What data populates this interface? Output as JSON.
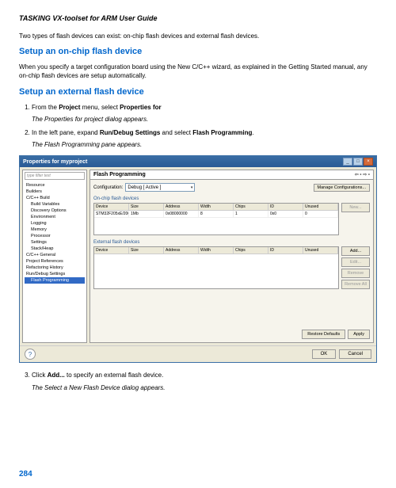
{
  "doc": {
    "header": "TASKING VX-toolset for ARM User Guide",
    "intro": "Two types of flash devices can exist: on-chip flash devices and external flash devices.",
    "h1": "Setup an on-chip flash device",
    "p1": "When you specify a target configuration board using the New C/C++ wizard, as explained in the Getting Started manual, any on-chip flash devices are setup automatically.",
    "h2": "Setup an external flash device",
    "step1_a": "From the ",
    "step1_b": "Project",
    "step1_c": " menu, select ",
    "step1_d": "Properties for",
    "step1_note": "The Properties for project dialog appears.",
    "step2_a": "In the left pane, expand ",
    "step2_b": "Run/Debug Settings",
    "step2_c": " and select ",
    "step2_d": "Flash Programming",
    "step2_e": ".",
    "step2_note": "The Flash Programming pane appears.",
    "step3_a": "Click ",
    "step3_b": "Add...",
    "step3_c": " to specify an external flash device.",
    "step3_note": "The Select a New Flash Device dialog appears.",
    "pagenum": "284"
  },
  "dialog": {
    "title": "Properties for myproject",
    "filter_placeholder": "type filter text",
    "tree": {
      "resource": "Resource",
      "builders": "Builders",
      "ccbuild": "C/C++ Build",
      "buildvars": "Build Variables",
      "discovery": "Discovery Options",
      "environment": "Environment",
      "logging": "Logging",
      "memory": "Memory",
      "processor": "Processor",
      "settings": "Settings",
      "stack": "Stack/Heap",
      "ccgeneral": "C/C++ General",
      "projrefs": "Project References",
      "refactoring": "Refactoring History",
      "rundebug": "Run/Debug Settings",
      "flashprog": "Flash Programming"
    },
    "pane_title": "Flash Programming",
    "config_label": "Configuration:",
    "config_value": "Debug [ Active ]",
    "manage": "Manage Configurations...",
    "onchip_label": "On-chip flash devices",
    "external_label": "External flash devices",
    "cols": {
      "device": "Device",
      "size": "Size",
      "address": "Address",
      "width": "Width",
      "chips": "Chips",
      "id": "ID",
      "unused": "Unused"
    },
    "row1": {
      "device": "STM32F205xE/206E",
      "size": "1Mb",
      "address": "0x08000000",
      "width": "8",
      "chips": "1",
      "id": "0x0",
      "unused": "0"
    },
    "btns": {
      "new": "New...",
      "add": "Add...",
      "edit": "Edit...",
      "remove": "Remove",
      "removeall": "Remove All",
      "restore": "Restore Defaults",
      "apply": "Apply",
      "ok": "OK",
      "cancel": "Cancel"
    }
  }
}
